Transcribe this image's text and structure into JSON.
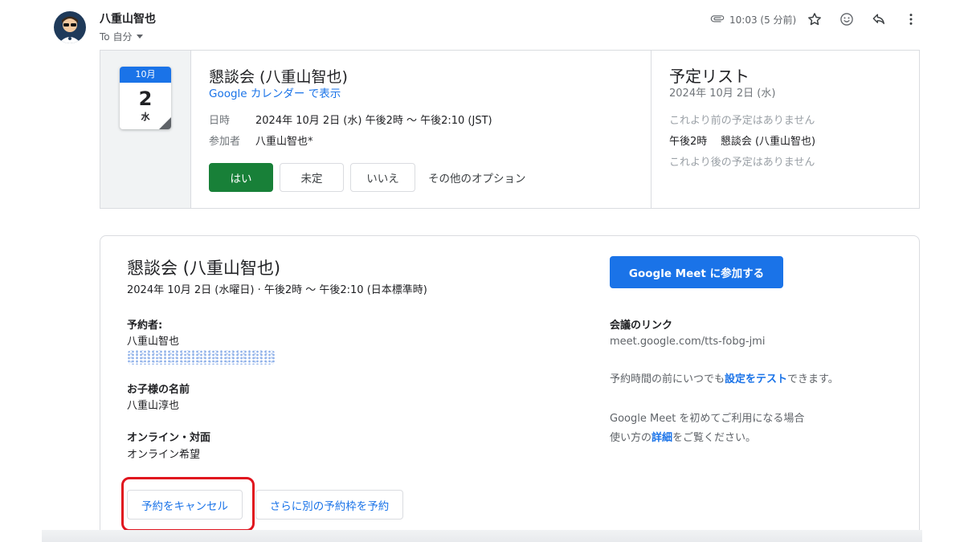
{
  "header": {
    "sender_name": "八重山智也",
    "recipient_label": "To 自分",
    "timestamp": "10:03 (5 分前)",
    "icons": [
      "paperclip-icon",
      "star-icon",
      "emoji-icon",
      "reply-icon",
      "more-vert-icon"
    ]
  },
  "invite": {
    "calendar_icon": {
      "month": "10月",
      "day": "2",
      "weekday": "水"
    },
    "event_title": "懇談会 (八重山智也)",
    "calendar_link": "Google カレンダー で表示",
    "when_label": "日時",
    "when_value": "2024年 10月 2日 (水) 午後2時 ～ 午後2:10 (JST)",
    "attendees_label": "参加者",
    "attendees_value": "八重山智也*",
    "rsvp": {
      "yes": "はい",
      "maybe": "未定",
      "no": "いいえ",
      "more": "その他のオプション"
    },
    "agenda": {
      "title": "予定リスト",
      "date": "2024年 10月 2日 (水)",
      "before": "これより前の予定はありません",
      "event_time": "午後2時",
      "event_name": "懇談会 (八重山智也)",
      "after": "これより後の予定はありません"
    }
  },
  "appointment": {
    "title": "懇談会 (八重山智也)",
    "when": "2024年 10月 2日 (水曜日) · 午後2時 ～ 午後2:10 (日本標準時)",
    "booker_label": "予約者:",
    "booker_name": "八重山智也",
    "child_label": "お子様の名前",
    "child_name": "八重山淳也",
    "mode_label": "オンライン・対面",
    "mode_value": "オンライン希望",
    "cancel_button": "予約をキャンセル",
    "rebook_button": "さらに別の予約枠を予約",
    "meet_button": "Google Meet に参加する",
    "meeting_link_label": "会議のリンク",
    "meeting_link": "meet.google.com/tts-fobg-jmi",
    "test_prefix": "予約時間の前にいつでも",
    "test_link": "設定をテスト",
    "test_suffix": "できます。",
    "first_time_line1": "Google Meet を初めてご利用になる場合",
    "first_time_prefix": "使い方の",
    "first_time_link": "詳細",
    "first_time_suffix": "をご覧ください。"
  },
  "colors": {
    "accent": "#1a73e8",
    "accept_green": "#188038",
    "highlight_red": "#e0141e"
  }
}
